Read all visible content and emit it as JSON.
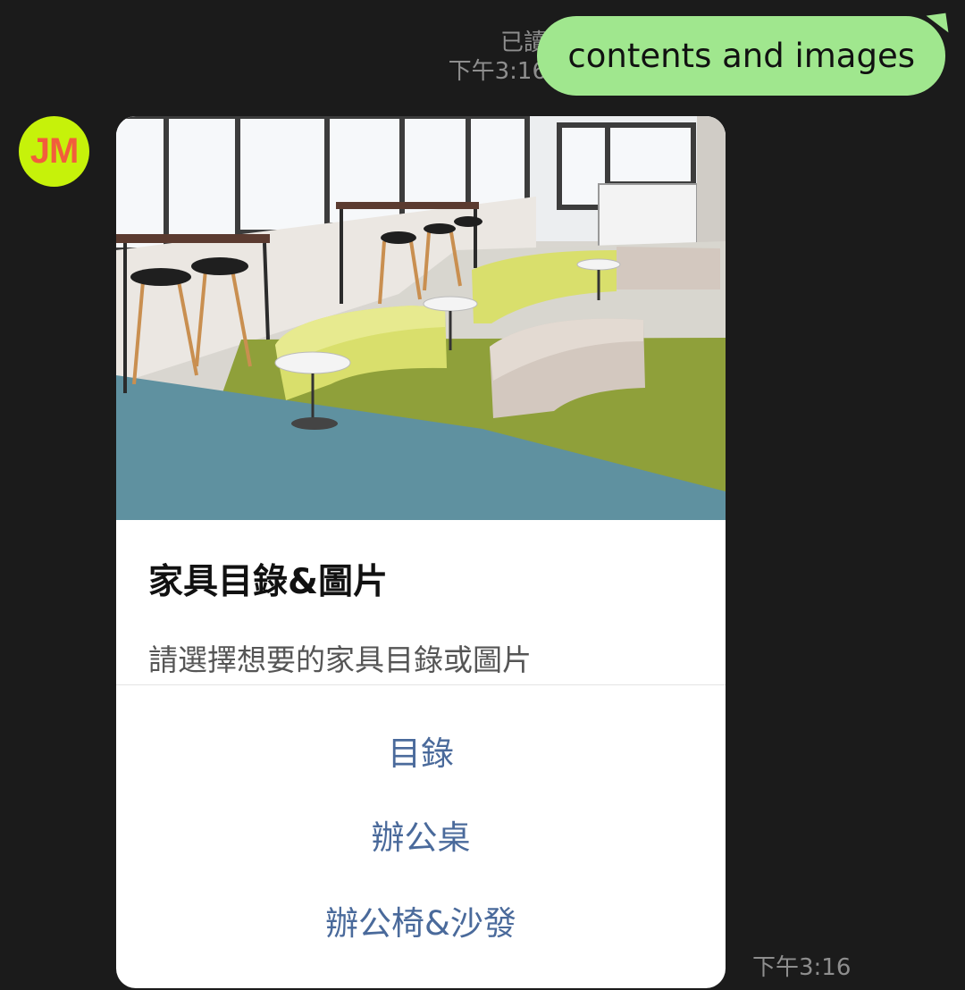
{
  "outgoing": {
    "read_status": "已讀",
    "time": "下午3:16",
    "message": "contents and images"
  },
  "incoming": {
    "avatar_text": "JM",
    "card": {
      "title": "家具目錄&圖片",
      "subtitle": "請選擇想要的家具目錄或圖片",
      "actions": [
        "目錄",
        "辦公桌",
        "辦公椅&沙發"
      ]
    },
    "time": "下午3:16"
  },
  "colors": {
    "background": "#1b1b1b",
    "outgoing_bubble": "#a0e78e",
    "avatar_bg": "#c6f20a",
    "avatar_text": "#f25d3c",
    "action_link": "#4a6a9b"
  }
}
